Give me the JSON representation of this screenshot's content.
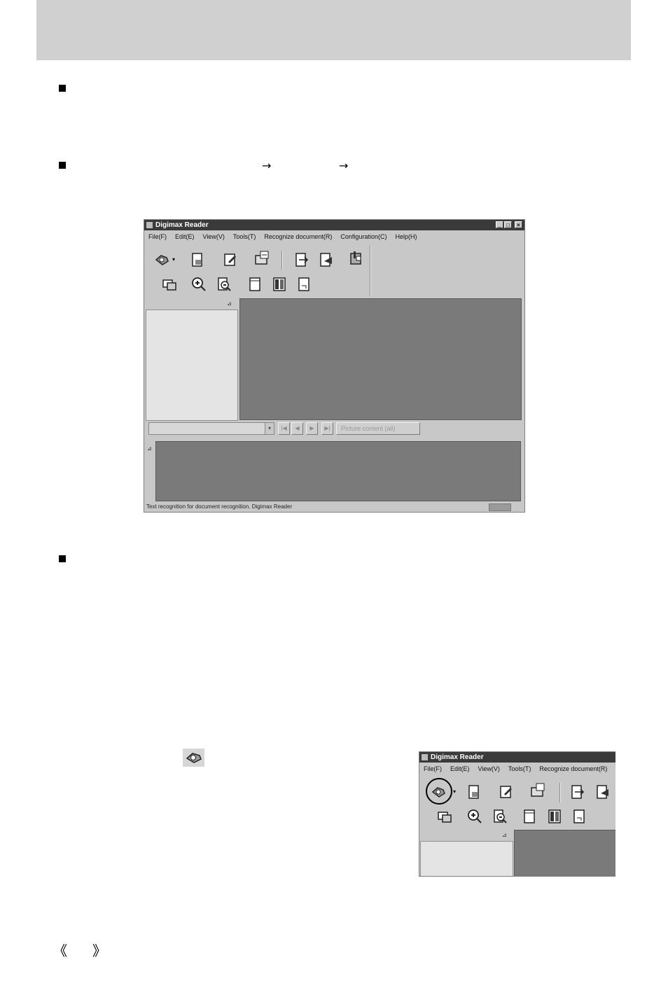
{
  "page_nav": {
    "left": "《",
    "right": "》"
  },
  "steps_line_arrows": [
    "→",
    "→"
  ],
  "main_window": {
    "title": "Digimax Reader",
    "menu": [
      "File(F)",
      "Edit(E)",
      "View(V)",
      "Tools(T)",
      "Recognize document(R)",
      "Configuration(C)",
      "Help(H)"
    ],
    "toolbar_row1": [
      "acquire-image-icon",
      "open-file-icon",
      "edit-icon",
      "export-icon",
      "recognize-icon",
      "recognize-save-icon",
      "settings-icon"
    ],
    "toolbar_row2": [
      "copy-icon",
      "zoom-in-icon",
      "zoom-out-icon",
      "page-icon",
      "columns-icon",
      "page-next-icon"
    ],
    "nav_buttons": [
      "|◀",
      "◀",
      "▶",
      "▶|"
    ],
    "nav_wide_label": "Picture content (all)",
    "status_text": "Text recognition for document recognition. Digimax Reader"
  },
  "zoom_window": {
    "title": "Digimax Reader",
    "menu": [
      "File(F)",
      "Edit(E)",
      "View(V)",
      "Tools(T)",
      "Recognize document(R)"
    ],
    "highlighted_tool": "acquire-image-icon"
  },
  "colors": {
    "header_band": "#d0d0d0",
    "title_bar": "#3a3a3a",
    "window_face": "#c8c8c8",
    "dark_pane": "#7a7a7a",
    "light_pane": "#e4e4e4"
  }
}
